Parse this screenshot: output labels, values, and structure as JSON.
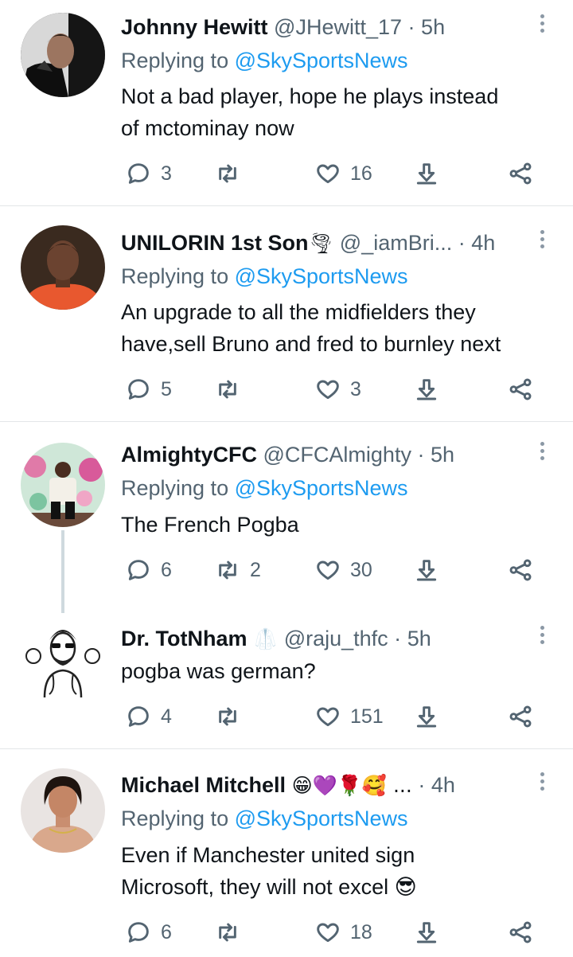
{
  "tweets": [
    {
      "name": "Johnny Hewitt",
      "name_emoji": "",
      "handle": "@JHewitt_17",
      "time": "5h",
      "replying_prefix": "Replying to ",
      "replying_to": "@SkySportsNews",
      "text_lines": [
        "Not a bad player, hope he plays instead",
        "of mctominay now"
      ],
      "replies": "3",
      "retweets": "",
      "likes": "16"
    },
    {
      "name": "UNILORIN 1st Son",
      "name_emoji": "🌪",
      "handle": "@_iamBri...",
      "time": "4h",
      "replying_prefix": "Replying to ",
      "replying_to": "@SkySportsNews",
      "text_lines": [
        "An upgrade to all the midfielders they",
        "have,sell Bruno and fred to burnley next"
      ],
      "replies": "5",
      "retweets": "",
      "likes": "3"
    },
    {
      "name": "AlmightyCFC",
      "name_emoji": "",
      "handle": "@CFCAlmighty",
      "time": "5h",
      "replying_prefix": "Replying to ",
      "replying_to": "@SkySportsNews",
      "text_lines": [
        "The French Pogba"
      ],
      "replies": "6",
      "retweets": "2",
      "likes": "30"
    },
    {
      "name": "Dr. TotNham",
      "name_emoji": "🥼",
      "handle": "@raju_thfc",
      "time": "5h",
      "text_lines": [
        "pogba was german?"
      ],
      "replies": "4",
      "retweets": "",
      "likes": "151"
    },
    {
      "name": "Michael Mitchell",
      "name_emoji": "😁💜🌹🥰 ...",
      "handle": "",
      "time": "4h",
      "replying_prefix": "Replying to ",
      "replying_to": "@SkySportsNews",
      "text_lines": [
        "Even if Manchester united sign",
        "Microsoft, they will not excel 😎"
      ],
      "replies": "6",
      "retweets": "",
      "likes": "18"
    }
  ],
  "separator": "·",
  "icons": [
    "reply-icon",
    "retweet-icon",
    "like-icon",
    "download-icon",
    "share-icon",
    "more-icon"
  ],
  "colors": {
    "text": "#0f1419",
    "secondary": "#536471",
    "link": "#1d9bf0",
    "divider": "#e3e6e8"
  }
}
